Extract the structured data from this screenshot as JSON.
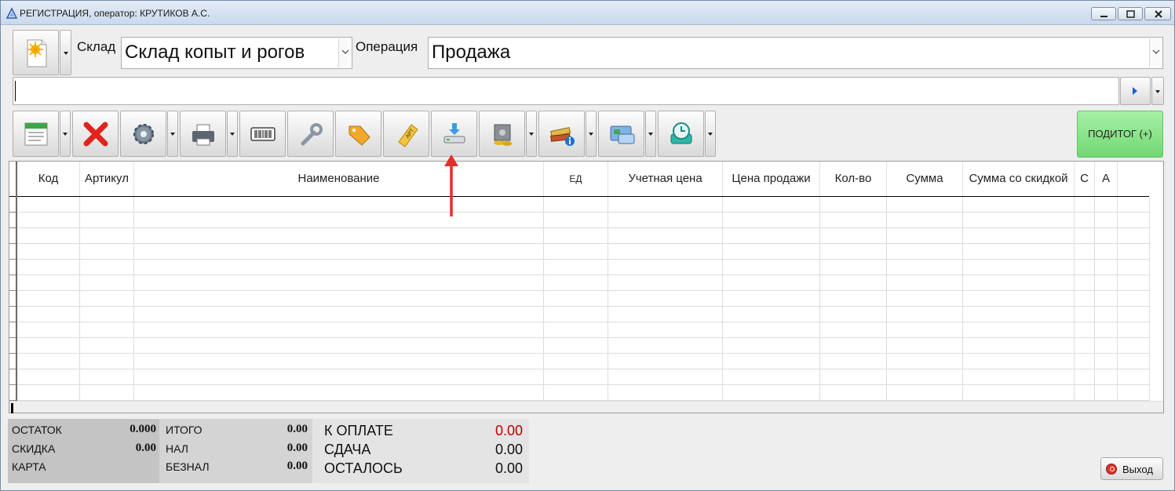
{
  "window": {
    "title": "РЕГИСТРАЦИЯ, оператор: КРУТИКОВ А.С."
  },
  "top": {
    "warehouse_label": "Склад",
    "warehouse_value": "Склад копыт и рогов",
    "operation_label": "Операция",
    "operation_value": "Продажа",
    "scanner_value": ""
  },
  "toolbar": {
    "tools": [
      {
        "name": "calendar-list-icon",
        "has_dropdown": true
      },
      {
        "name": "delete-icon",
        "has_dropdown": false
      },
      {
        "name": "gear-icon",
        "has_dropdown": true
      },
      {
        "name": "printer-icon",
        "has_dropdown": true
      },
      {
        "name": "barcode-icon",
        "has_dropdown": false
      },
      {
        "name": "wrench-icon",
        "has_dropdown": false
      },
      {
        "name": "price-tag-icon",
        "has_dropdown": false
      },
      {
        "name": "article-tag-icon",
        "has_dropdown": false
      },
      {
        "name": "download-scale-icon",
        "has_dropdown": false
      },
      {
        "name": "safe-money-icon",
        "has_dropdown": true
      },
      {
        "name": "books-info-icon",
        "has_dropdown": true
      },
      {
        "name": "payment-card-icon",
        "has_dropdown": true
      },
      {
        "name": "clock-drive-icon",
        "has_dropdown": true
      }
    ],
    "subtotal_label": "ПОДИТОГ (+)"
  },
  "grid": {
    "columns": [
      "Код",
      "Артикул",
      "Наименование",
      "ЕД",
      "Учетная цена",
      "Цена продажи",
      "Кол-во",
      "Сумма",
      "Сумма со скидкой",
      "С",
      "А"
    ],
    "rows": []
  },
  "summary": {
    "remainder_label": "ОСТАТОК",
    "remainder_value": "0.000",
    "discount_label": "СКИДКА",
    "discount_value": "0.00",
    "card_label": "КАРТА",
    "total_label": "ИТОГО",
    "total_value": "0.00",
    "cash_label": "НАЛ",
    "cash_value": "0.00",
    "noncash_label": "БЕЗНАЛ",
    "noncash_value": "0.00",
    "to_pay_label": "К ОПЛАТЕ",
    "to_pay_value": "0.00",
    "change_label": "СДАЧА",
    "change_value": "0.00",
    "left_label": "ОСТАЛОСЬ",
    "left_value": "0.00"
  },
  "footer": {
    "exit_label": "Выход"
  },
  "colors": {
    "to_pay_value": "#c00000",
    "subtotal_bg": "#8ee68e",
    "annotation_arrow": "#e0302a"
  }
}
